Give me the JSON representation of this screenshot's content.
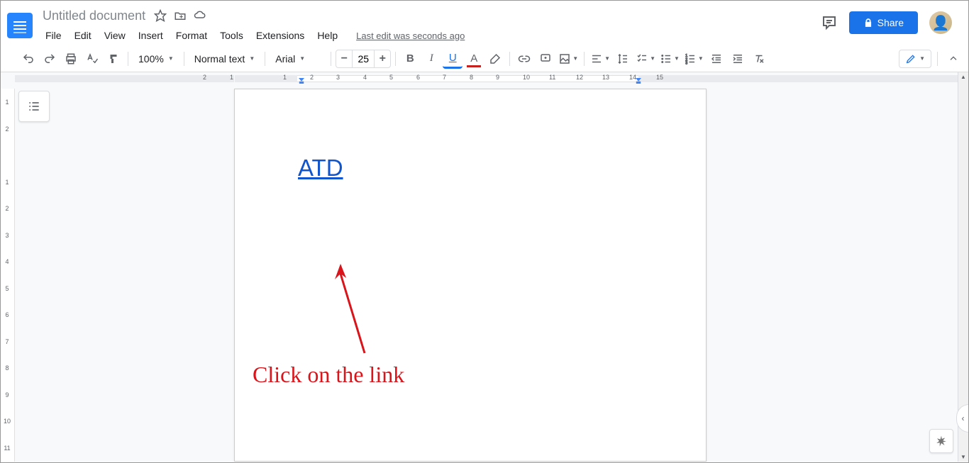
{
  "header": {
    "doc_title": "Untitled document",
    "last_edit": "Last edit was seconds ago",
    "share_label": "Share"
  },
  "menubar": [
    "File",
    "Edit",
    "View",
    "Insert",
    "Format",
    "Tools",
    "Extensions",
    "Help"
  ],
  "toolbar": {
    "zoom": "100%",
    "style": "Normal text",
    "font": "Arial",
    "font_size": "25"
  },
  "ruler": {
    "h_numbers": [
      2,
      1,
      1,
      2,
      3,
      4,
      5,
      6,
      7,
      8,
      9,
      10,
      11,
      12,
      13,
      14,
      15
    ],
    "v_numbers": [
      1,
      2,
      1,
      2,
      3,
      4,
      5,
      6,
      7,
      8,
      9,
      10,
      11
    ]
  },
  "document": {
    "link_text": "ATD"
  },
  "annotation": {
    "text": "Click on the link"
  }
}
